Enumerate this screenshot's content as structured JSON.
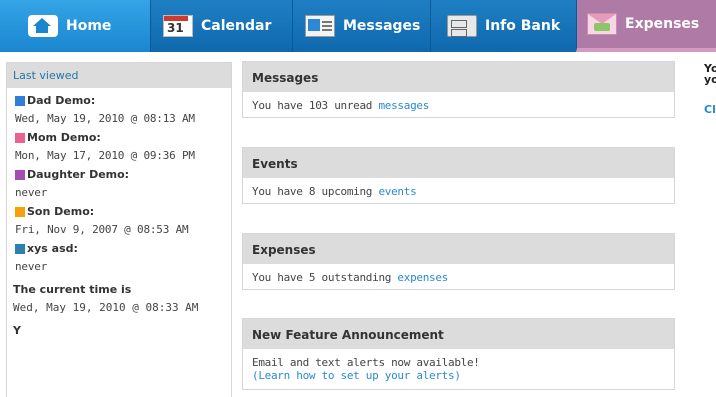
{
  "nav": {
    "tabs": [
      {
        "label": "Home",
        "icon": "home-icon"
      },
      {
        "label": "Calendar",
        "icon": "calendar-icon",
        "icon_text": "31"
      },
      {
        "label": "Messages",
        "icon": "messages-icon"
      },
      {
        "label": "Info Bank",
        "icon": "cabinet-icon"
      },
      {
        "label": "Expenses",
        "icon": "envelope-money-icon"
      }
    ],
    "colors": {
      "bar": "#0f68ad",
      "active": "#35a4e6",
      "expenses": "#b07aa6"
    }
  },
  "sidebar": {
    "header": "Last viewed",
    "people": [
      {
        "name": "Dad Demo:",
        "time": "Wed, May 19, 2010 @ 08:13 AM",
        "color": "#2f7fd6"
      },
      {
        "name": "Mom Demo:",
        "time": "Mon, May 17, 2010 @ 09:36 PM",
        "color": "#e8638f"
      },
      {
        "name": "Daughter Demo:",
        "time": "never",
        "color": "#a24fb0"
      },
      {
        "name": "Son Demo:",
        "time": "Fri, Nov 9, 2007 @ 08:53 AM",
        "color": "#f5a00c"
      },
      {
        "name": "xys asd:",
        "time": "never",
        "color": "#2f7fb0"
      }
    ],
    "clock_label": "The current time is",
    "clock_value": "Wed, May 19, 2010 @ 08:33 AM",
    "cut_text": "Y"
  },
  "cards": {
    "messages": {
      "title": "Messages",
      "prefix": "You have 103 unread ",
      "link": "messages"
    },
    "events": {
      "title": "Events",
      "prefix": "You have 8 upcoming ",
      "link": "events"
    },
    "expenses": {
      "title": "Expenses",
      "prefix": "You have 5 outstanding ",
      "link": "expenses"
    },
    "announcement": {
      "title": "New Feature Announcement",
      "line1": "Email and text alerts now available!",
      "link": "(Learn how to set up your alerts)"
    }
  },
  "right": {
    "line1": "Yo",
    "line2": "yo",
    "link": "Cl"
  }
}
